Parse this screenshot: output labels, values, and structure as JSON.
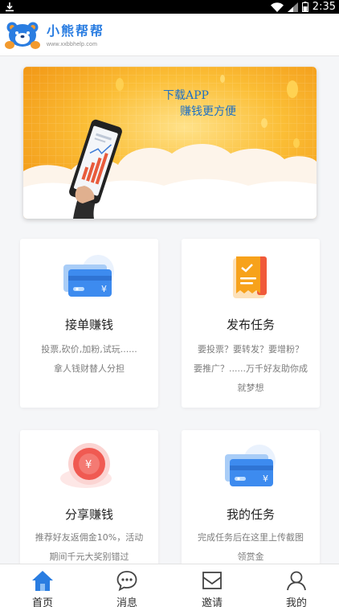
{
  "status_bar": {
    "time": "2:35"
  },
  "header": {
    "brand_name": "小熊帮帮",
    "brand_url": "www.xxbbhelp.com"
  },
  "banner": {
    "line1": "下载APP",
    "line2": "赚钱更方便"
  },
  "cards": [
    {
      "title": "接单赚钱",
      "desc_lines": [
        "投票,砍价,加粉,试玩......",
        "拿人钱财替人分担"
      ]
    },
    {
      "title": "发布任务",
      "desc_lines": [
        "要投票？要转发？要增粉？",
        "要推广？......万千好友助你成",
        "就梦想"
      ]
    },
    {
      "title": "分享赚钱",
      "desc_lines": [
        "推荐好友返佣金10%，活动",
        "期间千元大奖别错过"
      ]
    },
    {
      "title": "我的任务",
      "desc_lines": [
        "完成任务后在这里上传截图",
        "领赏金"
      ]
    }
  ],
  "bottom_nav": [
    {
      "label": "首页",
      "active": true
    },
    {
      "label": "消息"
    },
    {
      "label": "邀请"
    },
    {
      "label": "我的"
    }
  ],
  "colors": {
    "brand_blue": "#2a7de1",
    "banner_orange": "#f7a21b",
    "card_blue": "#3d8bef",
    "card_red": "#f05a52"
  },
  "icons": [
    "download-icon",
    "wifi-icon",
    "signal-icon",
    "battery-icon",
    "bear-logo-icon",
    "phone-chart-icon",
    "bank-card-icon",
    "receipt-icon",
    "coin-icon",
    "home-icon",
    "message-icon",
    "invite-icon",
    "user-icon"
  ]
}
